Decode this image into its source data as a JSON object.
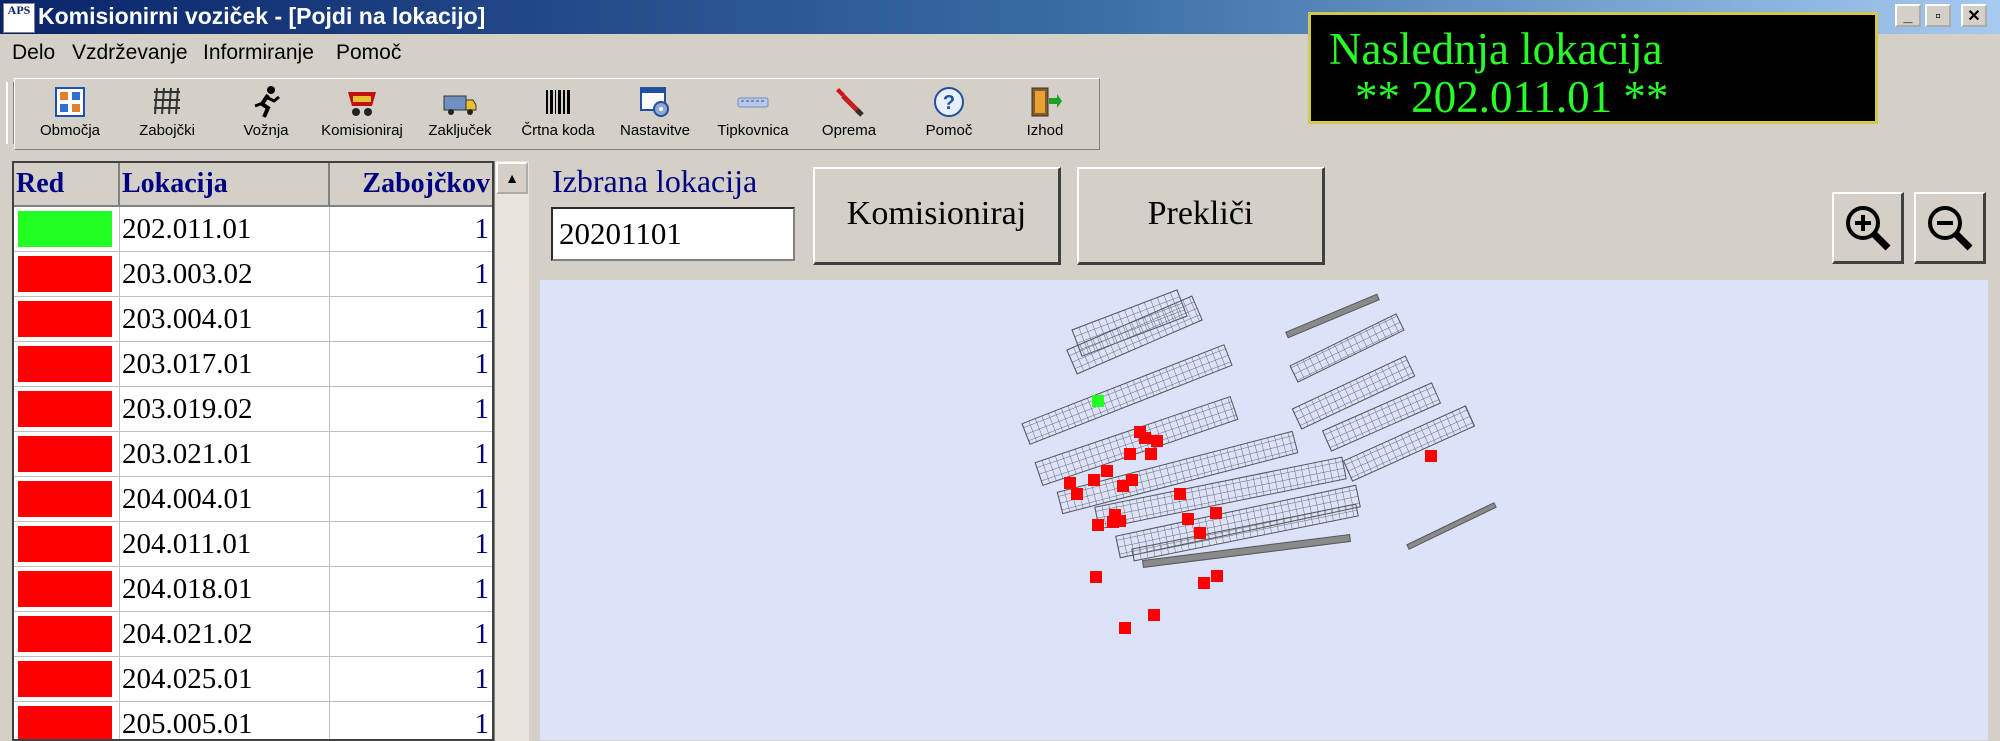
{
  "window": {
    "title": "Komisionirni voziček - [Pojdi na lokacijo]",
    "icon_text": "APS",
    "controls": [
      "_",
      "▫",
      "✕"
    ]
  },
  "menu": [
    "Delo",
    "Vzdrževanje",
    "Informiranje",
    "Pomoč"
  ],
  "toolbar": [
    {
      "label": "Območja",
      "icon": "areas-grid-icon"
    },
    {
      "label": "Zabojčki",
      "icon": "boxes-icon"
    },
    {
      "label": "Vožnja",
      "icon": "running-man-icon"
    },
    {
      "label": "Komisioniraj",
      "icon": "pick-basket-icon"
    },
    {
      "label": "Zaključek",
      "icon": "truck-icon"
    },
    {
      "label": "Črtna koda",
      "icon": "barcode-icon"
    },
    {
      "label": "Nastavitve",
      "icon": "settings-window-icon"
    },
    {
      "label": "Tipkovnica",
      "icon": "keyboard-icon"
    },
    {
      "label": "Oprema",
      "icon": "tool-icon"
    },
    {
      "label": "Pomoč",
      "icon": "help-icon"
    },
    {
      "label": "Izhod",
      "icon": "exit-door-icon"
    }
  ],
  "next_location": {
    "title": "Naslednja lokacija",
    "value": "** 202.011.01 **",
    "color": "#28ff28"
  },
  "grid": {
    "headers": [
      "Red",
      "Lokacija",
      "Zabojčkov"
    ],
    "rows": [
      {
        "status": "#22ff22",
        "location": "202.011.01",
        "count": "1"
      },
      {
        "status": "#ff0000",
        "location": "203.003.02",
        "count": "1"
      },
      {
        "status": "#ff0000",
        "location": "203.004.01",
        "count": "1"
      },
      {
        "status": "#ff0000",
        "location": "203.017.01",
        "count": "1"
      },
      {
        "status": "#ff0000",
        "location": "203.019.02",
        "count": "1"
      },
      {
        "status": "#ff0000",
        "location": "203.021.01",
        "count": "1"
      },
      {
        "status": "#ff0000",
        "location": "204.004.01",
        "count": "1"
      },
      {
        "status": "#ff0000",
        "location": "204.011.01",
        "count": "1"
      },
      {
        "status": "#ff0000",
        "location": "204.018.01",
        "count": "1"
      },
      {
        "status": "#ff0000",
        "location": "204.021.02",
        "count": "1"
      },
      {
        "status": "#ff0000",
        "location": "204.025.01",
        "count": "1"
      },
      {
        "status": "#ff0000",
        "location": "205.005.01",
        "count": "1"
      }
    ]
  },
  "selection": {
    "label": "Izbrana lokacija",
    "value": "20201101"
  },
  "buttons": {
    "pick": "Komisioniraj",
    "cancel": "Prekliči"
  },
  "zoom": {
    "in_icon": "zoom-in-icon",
    "out_icon": "zoom-out-icon"
  },
  "colors": {
    "map_background": "#dbe2fa",
    "pending": "#ff0000",
    "current": "#22ff22"
  }
}
